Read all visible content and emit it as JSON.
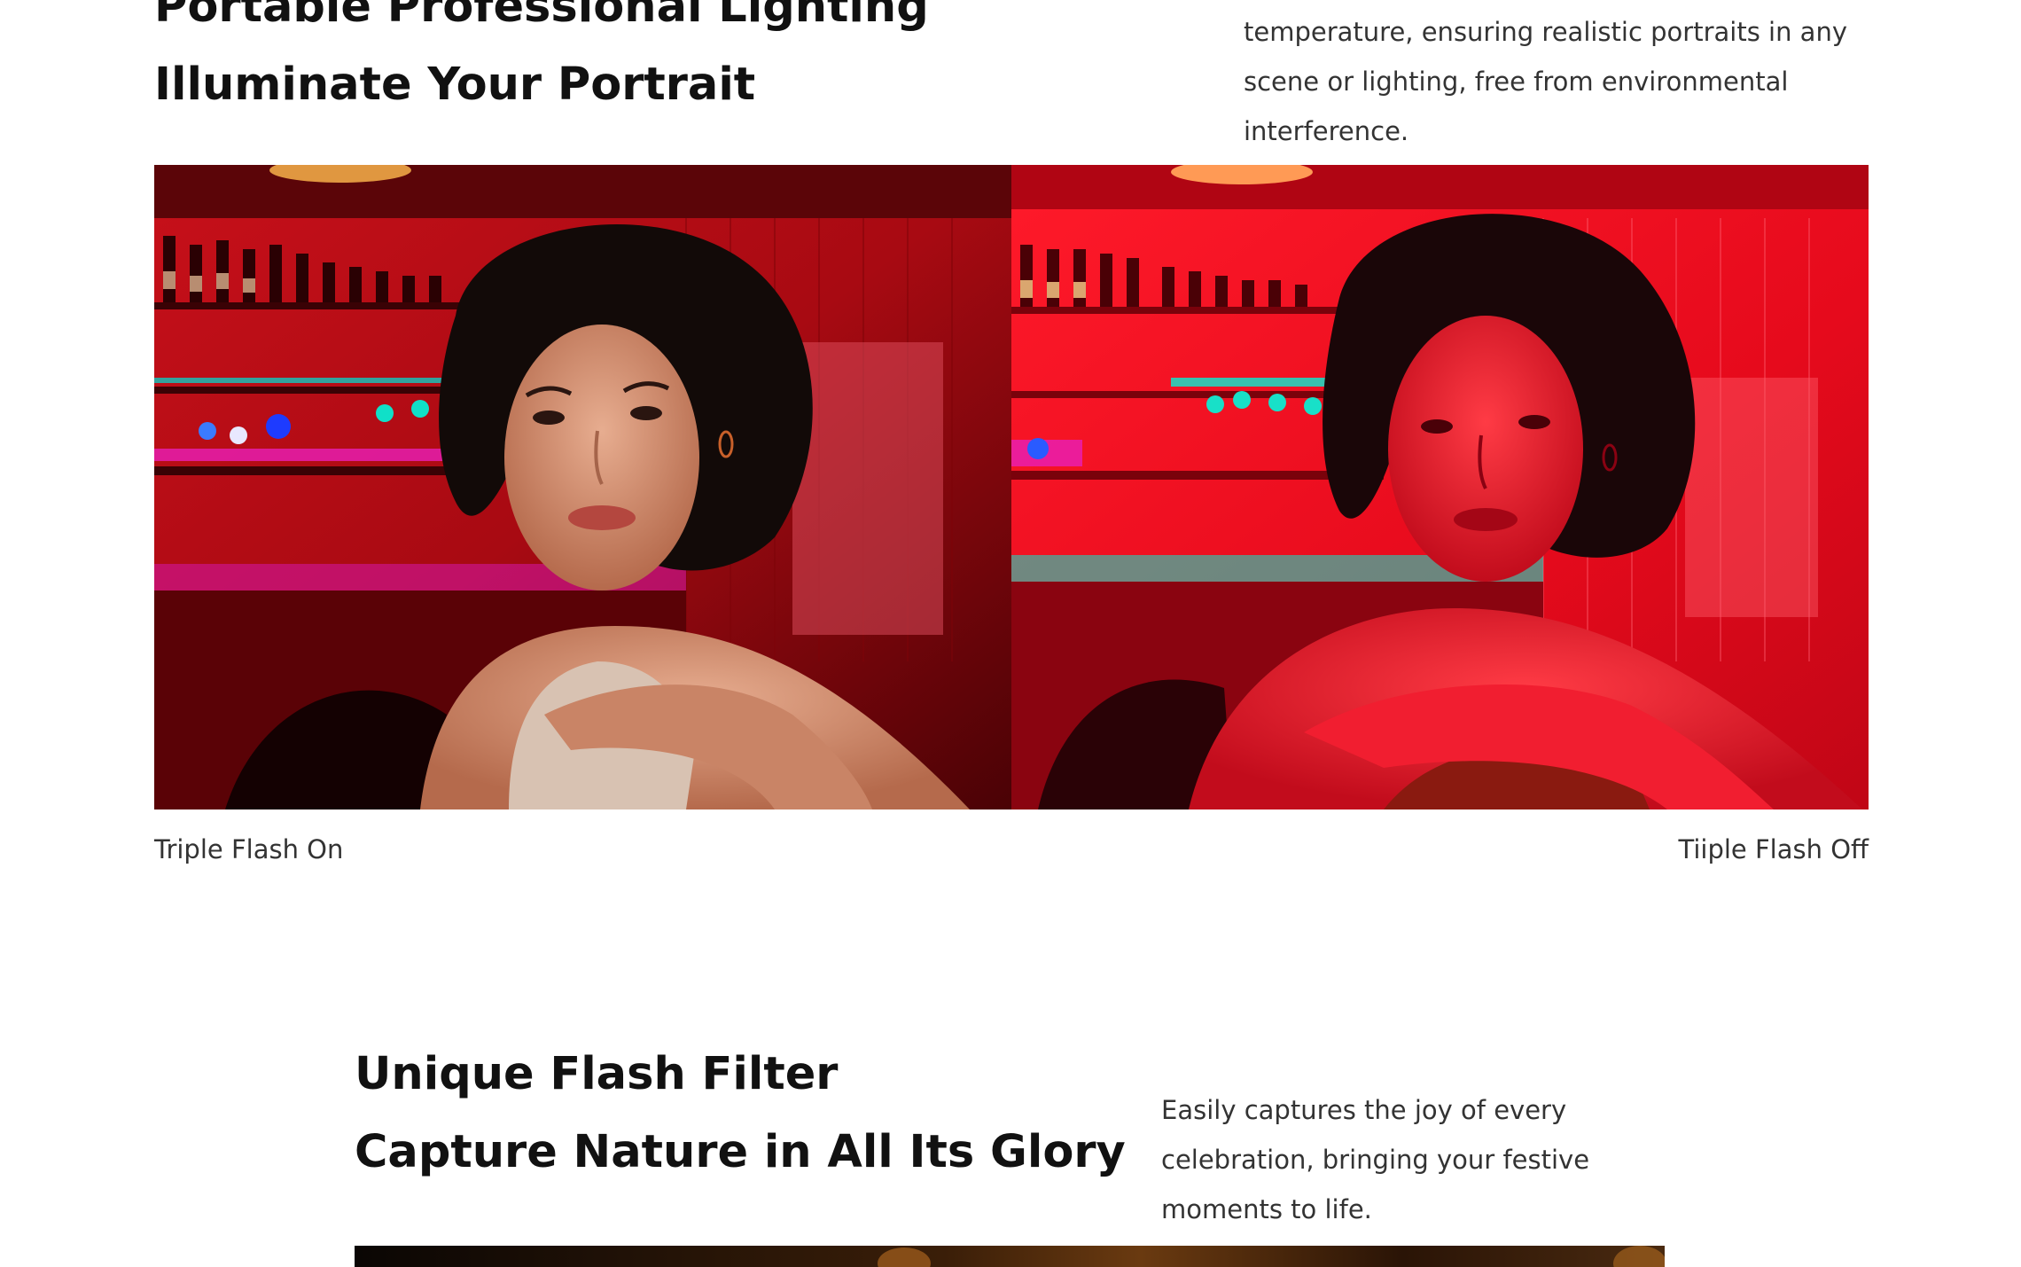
{
  "section_portrait": {
    "title_line1": "Portable Professional Lighting",
    "title_line2": "Illuminate Your Portrait",
    "description": "temperature, ensuring realistic portraits in any scene or lighting, free from environmental interference.",
    "caption_left": "Triple Flash On",
    "caption_right": "Tiiple Flash Off"
  },
  "section_filter": {
    "title_line1": "Unique Flash Filter",
    "title_line2": "Capture Nature in All Its Glory",
    "description": "Easily captures the joy of every celebration, bringing your festive moments to life."
  }
}
